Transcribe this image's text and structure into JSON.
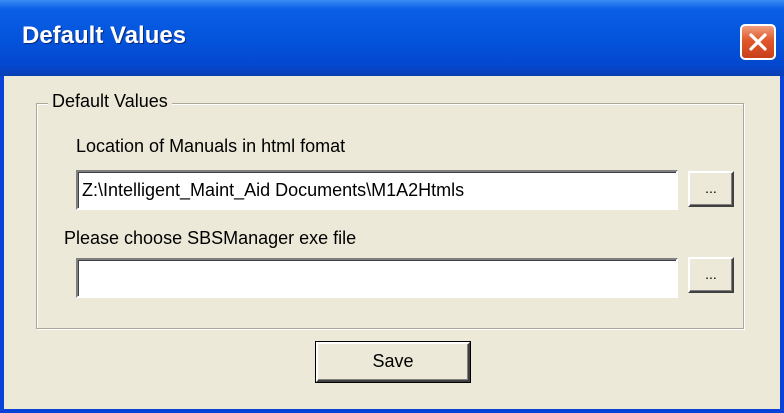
{
  "window": {
    "title": "Default Values"
  },
  "group": {
    "legend": "Default Values"
  },
  "manuals": {
    "label": "Location of Manuals in html fomat",
    "value": "Z:\\Intelligent_Maint_Aid Documents\\M1A2Htmls",
    "browse_label": "..."
  },
  "sbs": {
    "label": "Please choose SBSManager exe file",
    "value": "",
    "browse_label": "..."
  },
  "actions": {
    "save_label": "Save"
  },
  "colors": {
    "title_bar": "#0454dc",
    "close_button": "#e0582a",
    "dialog_background": "#ece9d8"
  },
  "icons": {
    "close": "close-icon"
  }
}
